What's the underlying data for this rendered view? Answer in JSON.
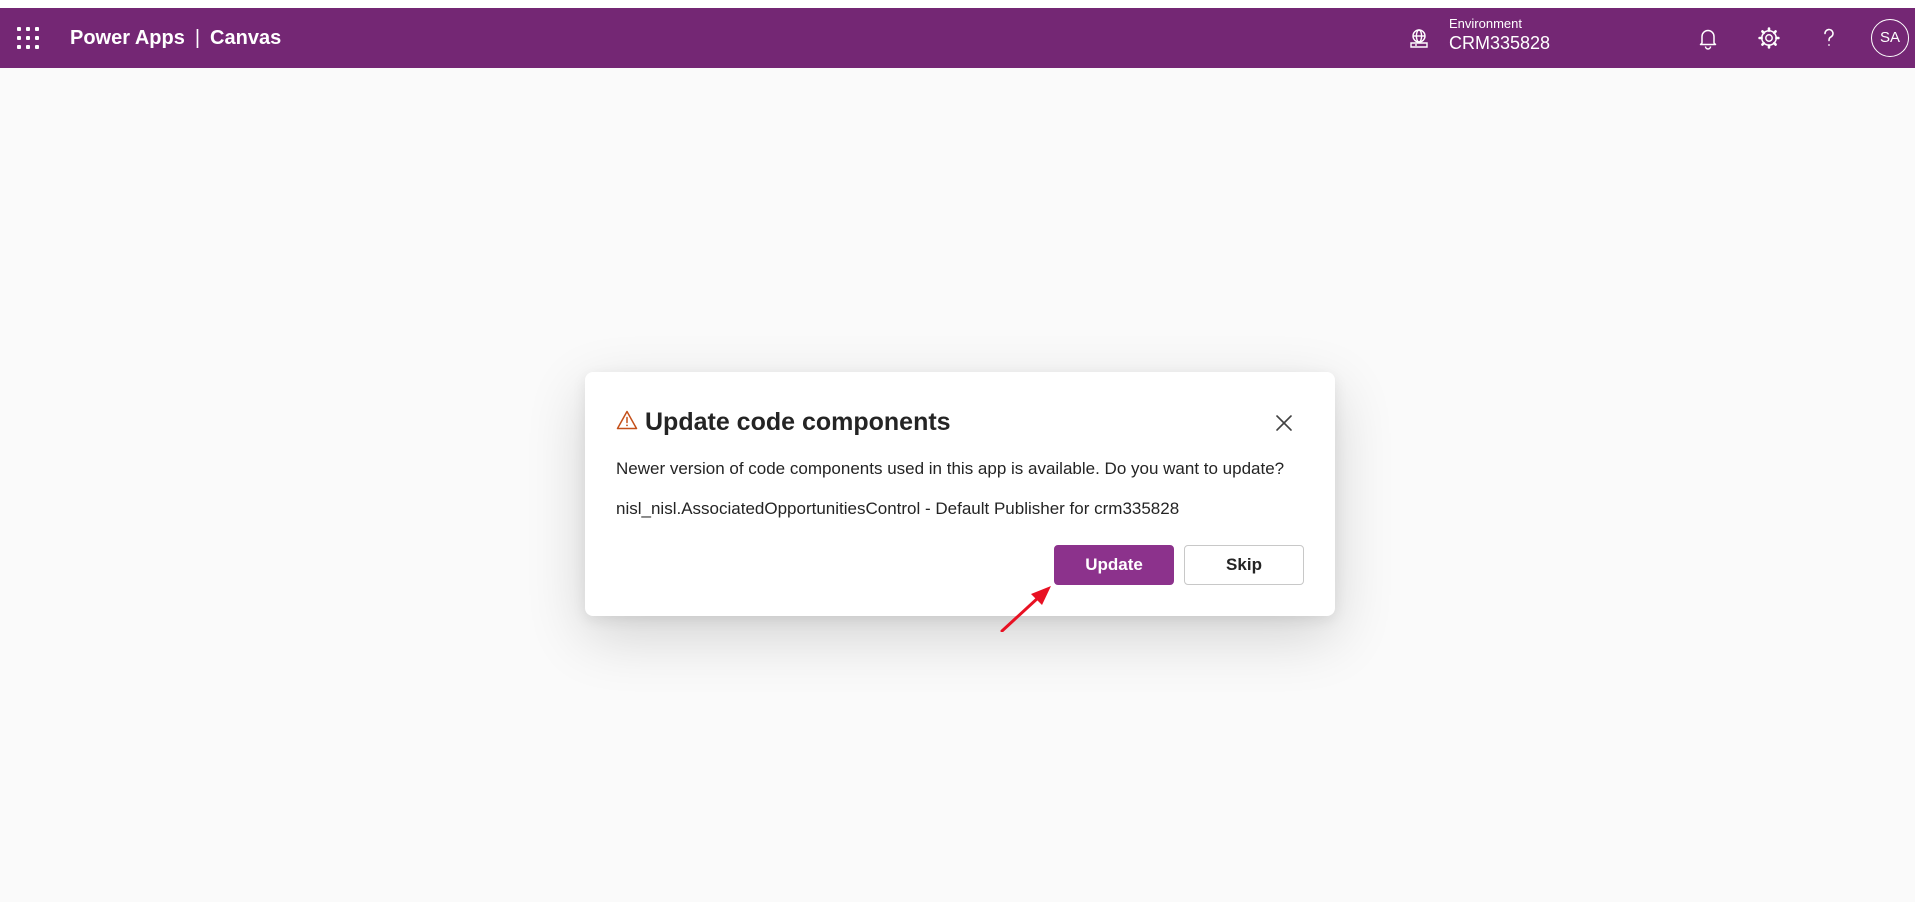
{
  "header": {
    "app_name": "Power Apps",
    "separator": "|",
    "section": "Canvas",
    "environment_label": "Environment",
    "environment_value": "CRM335828",
    "avatar_initials": "SA",
    "icons": [
      "app-launcher-icon",
      "environment-icon",
      "bell-icon",
      "gear-icon",
      "help-icon"
    ]
  },
  "dialog": {
    "title": "Update code components",
    "message": "Newer version of code components used in this app is available. Do you want to update?",
    "component": "nisl_nisl.AssociatedOpportunitiesControl - Default Publisher for crm335828",
    "update_label": "Update",
    "skip_label": "Skip",
    "icons": [
      "warning-icon",
      "close-icon"
    ]
  },
  "colors": {
    "header_bg": "#742774",
    "primary_button": "#8c328c",
    "warning_icon": "#c4501a",
    "annotation_arrow": "#e81123",
    "page_bg": "#fafafa"
  }
}
